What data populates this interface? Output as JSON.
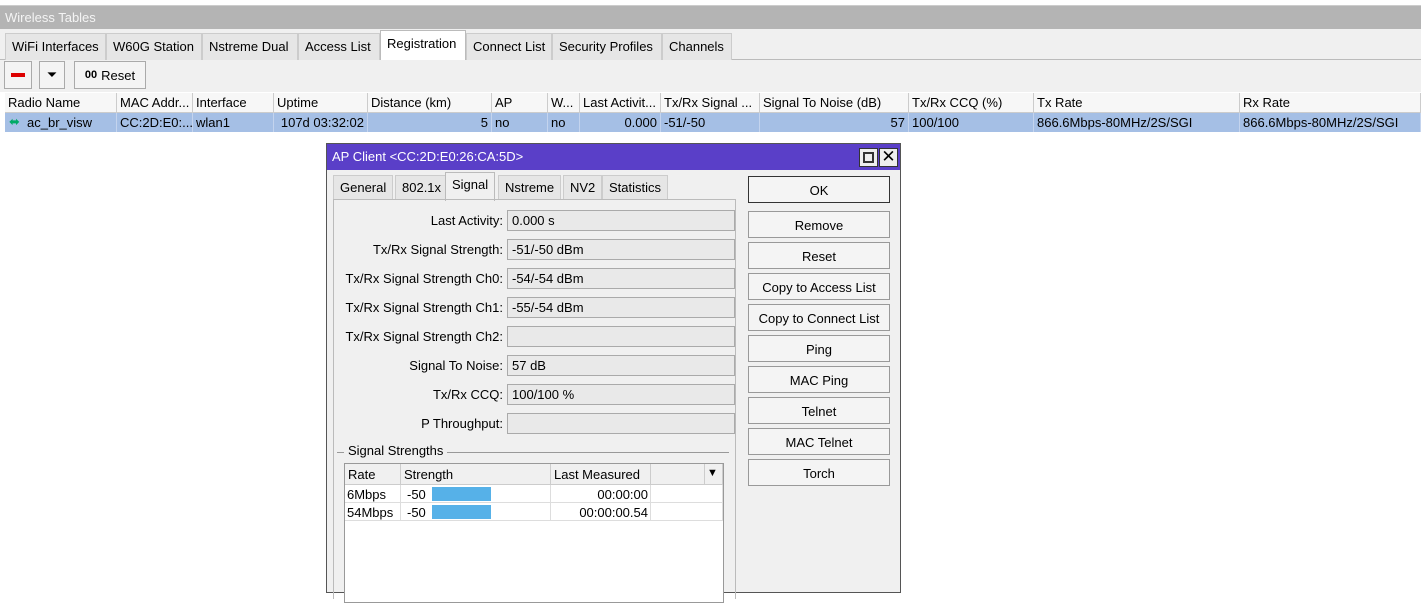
{
  "window": {
    "title": "Wireless Tables"
  },
  "tabs": [
    "WiFi Interfaces",
    "W60G Station",
    "Nstreme Dual",
    "Access List",
    "Registration",
    "Connect List",
    "Security Profiles",
    "Channels"
  ],
  "toolbar": {
    "reset_label": "Reset",
    "reset_prefix": "00"
  },
  "table": {
    "columns": [
      "Radio Name",
      "MAC Addr...",
      "Interface",
      "Uptime",
      "Distance (km)",
      "AP",
      "W...",
      "Last Activit...",
      "Tx/Rx Signal ...",
      "Signal To Noise (dB)",
      "Tx/Rx CCQ (%)",
      "Tx Rate",
      "Rx Rate"
    ],
    "rows": [
      [
        "ac_br_visw",
        "CC:2D:E0:...",
        "wlan1",
        "107d 03:32:02",
        "5",
        "no",
        "no",
        "0.000",
        "-51/-50",
        "57",
        "100/100",
        "866.6Mbps-80MHz/2S/SGI",
        "866.6Mbps-80MHz/2S/SGI"
      ]
    ]
  },
  "dialog": {
    "title": "AP Client <CC:2D:E0:26:CA:5D>",
    "tabs": [
      "General",
      "802.1x",
      "Signal",
      "Nstreme",
      "NV2",
      "Statistics"
    ],
    "fields": [
      {
        "label": "Last Activity:",
        "value": "0.000 s"
      },
      {
        "label": "Tx/Rx Signal Strength:",
        "value": "-51/-50 dBm"
      },
      {
        "label": "Tx/Rx Signal Strength Ch0:",
        "value": "-54/-54 dBm"
      },
      {
        "label": "Tx/Rx Signal Strength Ch1:",
        "value": "-55/-54 dBm"
      },
      {
        "label": "Tx/Rx Signal Strength Ch2:",
        "value": ""
      },
      {
        "label": "Signal To Noise:",
        "value": "57 dB"
      },
      {
        "label": "Tx/Rx CCQ:",
        "value": "100/100 %"
      },
      {
        "label": "P Throughput:",
        "value": ""
      }
    ],
    "group_title": "Signal Strengths",
    "list": {
      "columns": [
        "Rate",
        "Strength",
        "Last Measured"
      ],
      "rows": [
        {
          "rate": "6Mbps",
          "strength": "-50",
          "last": "00:00:00"
        },
        {
          "rate": "54Mbps",
          "strength": "-50",
          "last": "00:00:00.54"
        }
      ]
    },
    "buttons": [
      "OK",
      "Remove",
      "Reset",
      "Copy to Access List",
      "Copy to Connect List",
      "Ping",
      "MAC Ping",
      "Telnet",
      "MAC Telnet",
      "Torch"
    ]
  }
}
